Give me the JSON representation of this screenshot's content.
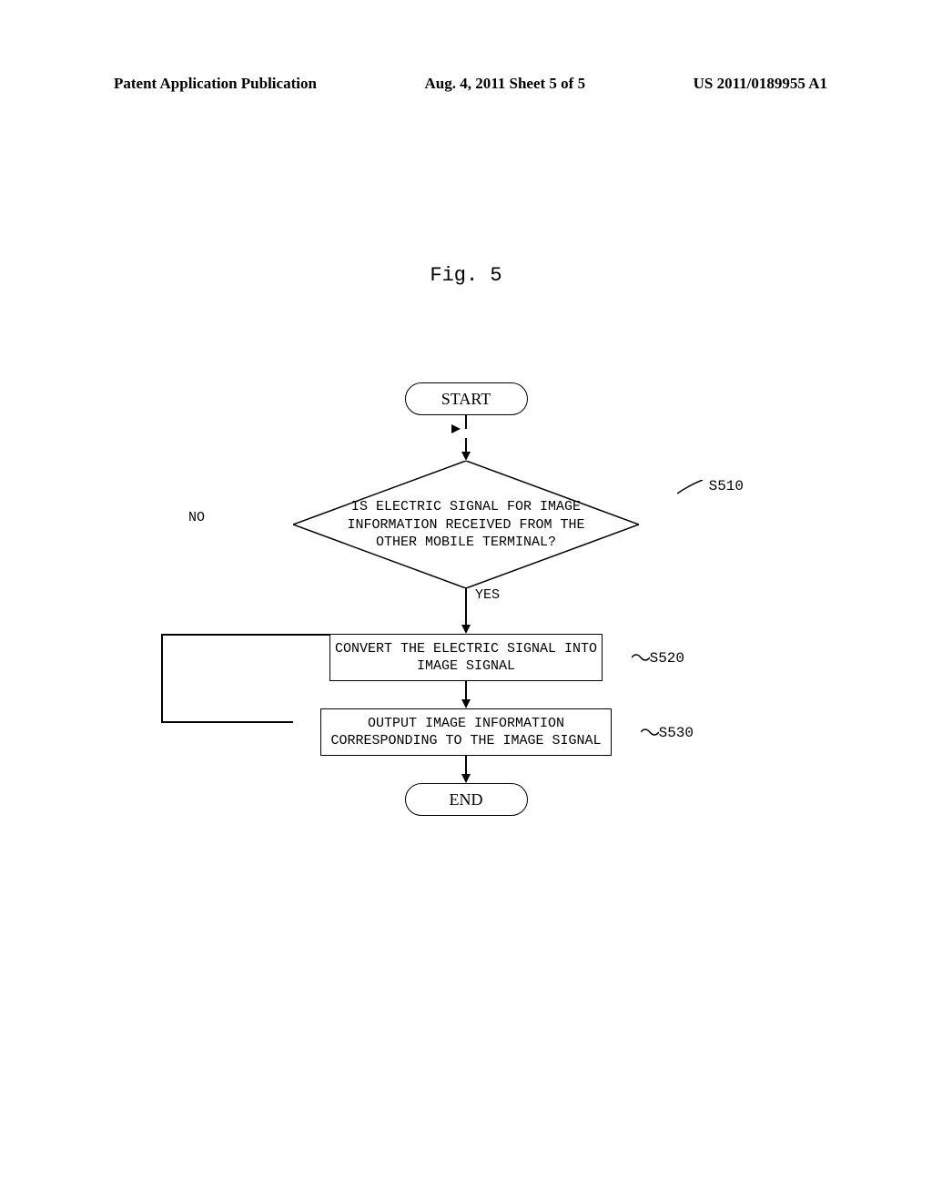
{
  "header": {
    "left": "Patent Application Publication",
    "center": "Aug. 4, 2011  Sheet 5 of 5",
    "right": "US 2011/0189955 A1"
  },
  "figure_title": "Fig. 5",
  "flowchart": {
    "start": "START",
    "end": "END",
    "decision": {
      "text": "IS ELECTRIC SIGNAL FOR IMAGE INFORMATION RECEIVED FROM THE OTHER MOBILE TERMINAL?",
      "yes": "YES",
      "no": "NO",
      "step": "S510"
    },
    "process1": {
      "text": "CONVERT THE ELECTRIC SIGNAL INTO IMAGE SIGNAL",
      "step": "S520"
    },
    "process2": {
      "text": "OUTPUT IMAGE INFORMATION CORRESPONDING TO THE IMAGE SIGNAL",
      "step": "S530"
    }
  }
}
